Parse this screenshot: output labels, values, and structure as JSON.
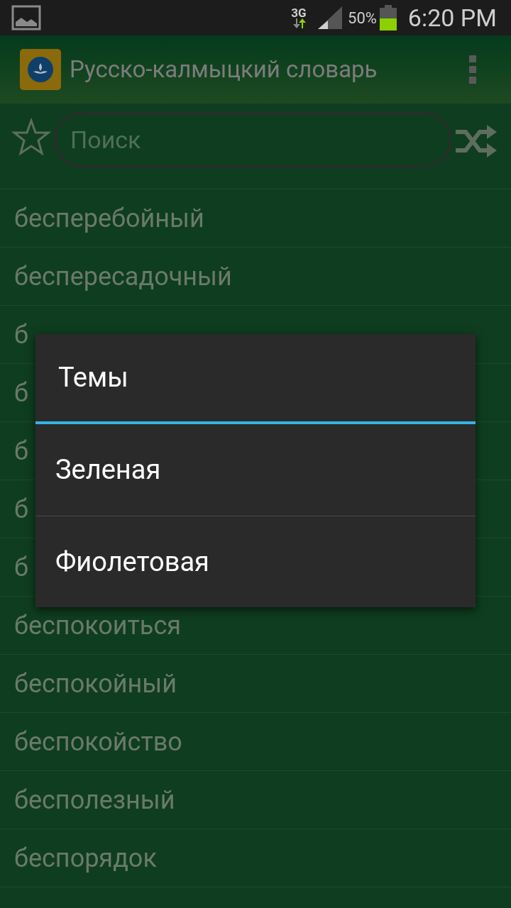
{
  "status_bar": {
    "network": "3G",
    "battery": "50%",
    "time": "6:20 PM"
  },
  "app_bar": {
    "title": "Русско-калмыцкий словарь"
  },
  "search": {
    "placeholder": "Поиск"
  },
  "words": [
    "бесперебойный",
    "беспересадочный",
    "б",
    "б",
    "б",
    "б",
    "б",
    "беспокоиться",
    "беспокойный",
    "беспокойство",
    "бесполезный",
    "беспорядок"
  ],
  "dialog": {
    "title": "Темы",
    "options": [
      "Зеленая",
      "Фиолетовая"
    ]
  }
}
